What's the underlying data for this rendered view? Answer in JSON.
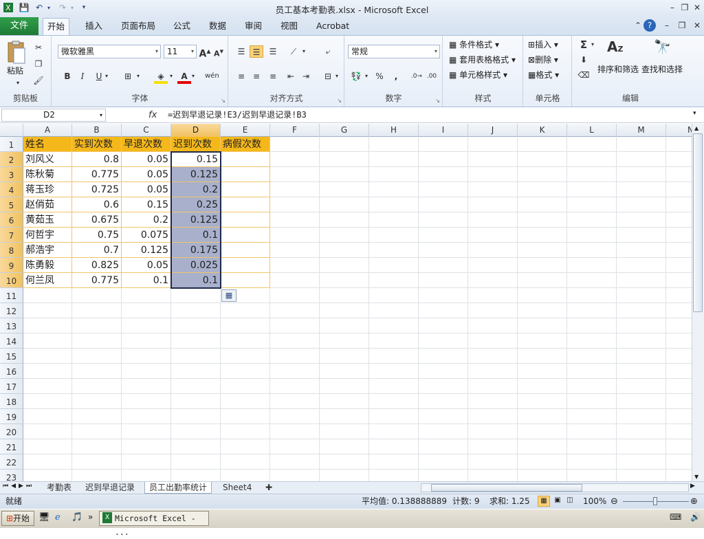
{
  "window": {
    "title": "员工基本考勤表.xlsx - Microsoft Excel"
  },
  "tabs": {
    "file": "文件",
    "items": [
      "开始",
      "插入",
      "页面布局",
      "公式",
      "数据",
      "审阅",
      "视图",
      "Acrobat"
    ]
  },
  "ribbon": {
    "clipboard": {
      "paste": "粘贴",
      "label": "剪贴板"
    },
    "font": {
      "name": "微软雅黑",
      "size": "11",
      "label": "字体",
      "bold": "B",
      "italic": "I",
      "underline": "U",
      "grow": "A",
      "shrink": "A"
    },
    "alignment": {
      "label": "对齐方式"
    },
    "number": {
      "format": "常规",
      "label": "数字",
      "percent": "%",
      "comma": ","
    },
    "styles": {
      "conditional": "条件格式",
      "table": "套用表格格式",
      "cell": "单元格样式",
      "label": "样式"
    },
    "cells": {
      "insert": "插入",
      "delete": "删除",
      "format": "格式",
      "label": "单元格"
    },
    "editing": {
      "sort": "排序和筛选",
      "find": "查找和选择",
      "label": "编辑",
      "sigma": "Σ"
    }
  },
  "formula_bar": {
    "name_box": "D2",
    "fx": "fx",
    "formula": "=迟到早退记录!E3/迟到早退记录!B3"
  },
  "columns": [
    "A",
    "B",
    "C",
    "D",
    "E",
    "F",
    "G",
    "H",
    "I",
    "J",
    "K",
    "L",
    "M",
    "N"
  ],
  "rows": [
    "1",
    "2",
    "3",
    "4",
    "5",
    "6",
    "7",
    "8",
    "9",
    "10",
    "11",
    "12",
    "13",
    "14",
    "15",
    "16",
    "17",
    "18",
    "19",
    "20",
    "21",
    "22",
    "23"
  ],
  "table": {
    "headers": [
      "姓名",
      "实到次数",
      "早退次数",
      "迟到次数",
      "病假次数"
    ],
    "names": [
      "刘风义",
      "陈秋菊",
      "蒋玉珍",
      "赵俏茹",
      "黄茹玉",
      "何哲宇",
      "郝浩宇",
      "陈勇毅",
      "何兰凤"
    ],
    "b": [
      "0.8",
      "0.775",
      "0.725",
      "0.6",
      "0.675",
      "0.75",
      "0.7",
      "0.825",
      "0.775"
    ],
    "c": [
      "0.05",
      "0.05",
      "0.05",
      "0.15",
      "0.2",
      "0.075",
      "0.125",
      "0.05",
      "0.1"
    ],
    "d": [
      "0.15",
      "0.125",
      "0.2",
      "0.25",
      "0.125",
      "0.1",
      "0.175",
      "0.025",
      "0.1"
    ]
  },
  "sheets": [
    "考勤表",
    "迟到早退记录",
    "员工出勤率统计",
    "Sheet4"
  ],
  "active_sheet": "员工出勤率统计",
  "status": {
    "ready": "就绪",
    "average": "平均值: 0.138888889",
    "count": "计数: 9",
    "sum": "求和: 1.25",
    "zoom": "100%"
  },
  "taskbar": {
    "start": "开始",
    "task": "Microsoft Excel - ..."
  }
}
